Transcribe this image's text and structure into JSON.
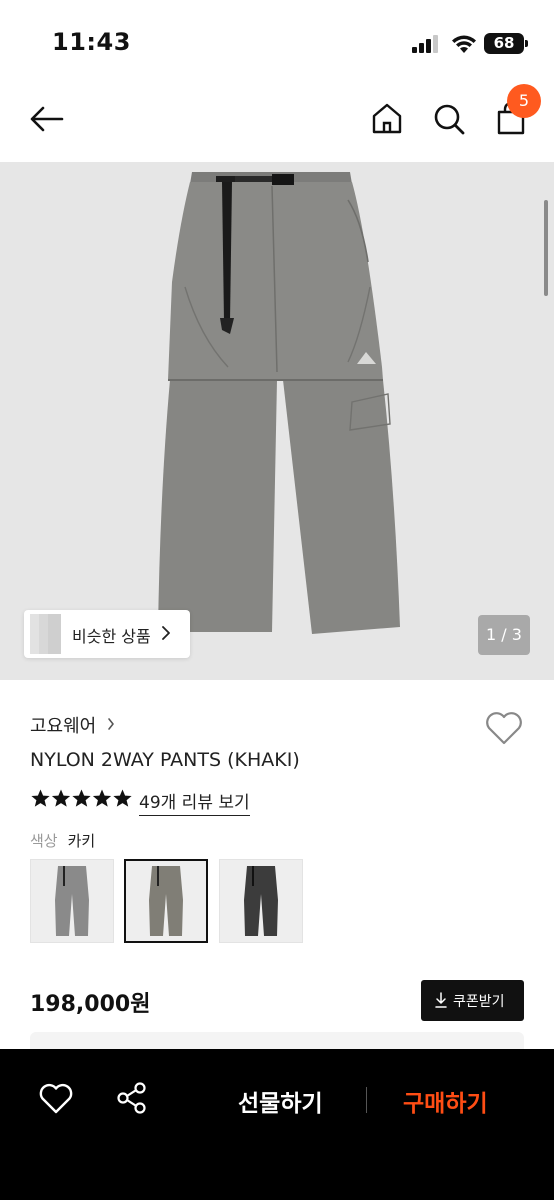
{
  "status_bar": {
    "time": "11:43",
    "battery": "68"
  },
  "header": {
    "cart_count": "5"
  },
  "hero": {
    "similar_label": "비슷한 상품",
    "page_indicator": "1 / 3"
  },
  "product": {
    "brand": "고요웨어",
    "name": "NYLON 2WAY PANTS (KHAKI)",
    "rating_stars": 5,
    "review_link": "49개 리뷰 보기",
    "color_label": "색상",
    "color_value": "카키",
    "swatches": [
      {
        "color": "#8a8a8a",
        "selected": false
      },
      {
        "color": "#807e76",
        "selected": true
      },
      {
        "color": "#3c3c3c",
        "selected": false
      }
    ],
    "price": "198,000원",
    "coupon_label": "쿠폰받기"
  },
  "bottom_bar": {
    "gift_label": "선물하기",
    "buy_label": "구매하기",
    "buy_color": "#ff4d14"
  }
}
